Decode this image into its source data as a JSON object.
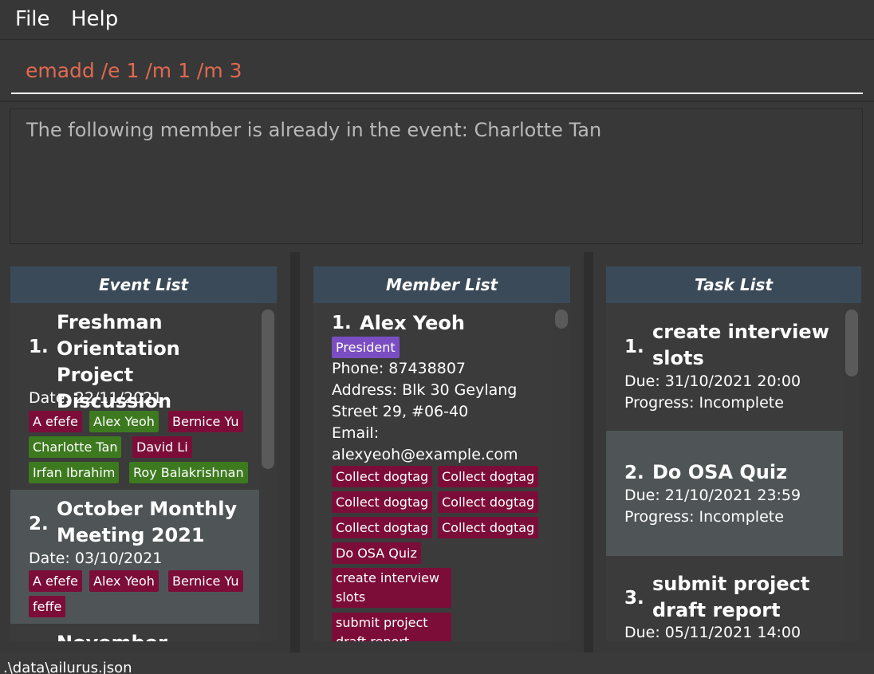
{
  "menu": {
    "file": "File",
    "help": "Help"
  },
  "command": {
    "value": "emadd /e 1 /m 1 /m 3"
  },
  "result": {
    "message": "The following member is already in the event: Charlotte Tan"
  },
  "event_list": {
    "header": "Event List",
    "items": [
      {
        "index": "1.",
        "title_lines": [
          "Freshman",
          "Orientation Project",
          "Discussion"
        ],
        "date": "Date: 22/11/2021",
        "tags": [
          "A efefe",
          "Alex Yeoh",
          "Bernice Yu",
          "Charlotte Tan",
          "David Li",
          "Irfan Ibrahim",
          "Roy Balakrishnan"
        ]
      },
      {
        "index": "2.",
        "title_lines": [
          "October Monthly",
          "Meeting 2021"
        ],
        "date": "Date: 03/10/2021",
        "tags": [
          "A efefe",
          "Alex Yeoh",
          "Bernice Yu",
          "feffe"
        ]
      },
      {
        "index": "",
        "title_lines": [
          "November Monthly"
        ]
      }
    ]
  },
  "member_list": {
    "header": "Member List",
    "items": [
      {
        "index": "1.",
        "name": "Alex Yeoh",
        "position": "President",
        "phone": "Phone: 87438807",
        "address_lines": [
          "Address: Blk 30 Geylang",
          "Street 29, #06-40"
        ],
        "email_label": "Email:",
        "email": "alexyeoh@example.com",
        "tasks": [
          "Collect dogtag",
          "Collect dogtag",
          "Collect dogtag",
          "Collect dogtag",
          "Collect dogtag",
          "Collect dogtag",
          "Do OSA Quiz",
          "create interview slots",
          "submit project draft report"
        ]
      }
    ]
  },
  "task_list": {
    "header": "Task List",
    "items": [
      {
        "index": "1.",
        "title_lines": [
          "create interview",
          "slots"
        ],
        "due": "Due: 31/10/2021 20:00",
        "progress": "Progress: Incomplete"
      },
      {
        "index": "2.",
        "title_lines": [
          "Do OSA Quiz"
        ],
        "due": "Due: 21/10/2021 23:59",
        "progress": "Progress: Incomplete"
      },
      {
        "index": "3.",
        "title_lines": [
          "submit project",
          "draft report"
        ],
        "due": "Due: 05/11/2021 14:00"
      }
    ]
  },
  "status": {
    "path": ".\\data\\ailurus.json"
  },
  "colors": {
    "tag_red": "#7c0d38",
    "tag_green": "#3d7a1f",
    "tag_purple": "#7a4ec2",
    "header_bg": "#3a4a58",
    "command_text": "#e06a50"
  }
}
